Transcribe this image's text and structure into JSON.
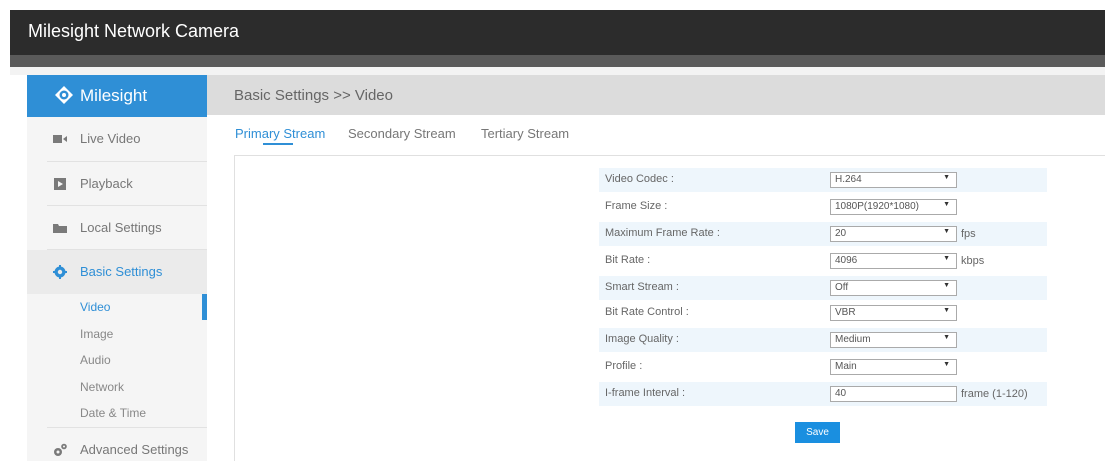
{
  "app": {
    "title": "Milesight Network Camera"
  },
  "brand": {
    "name": "Milesight",
    "accent_color": "#2f8fd6"
  },
  "sidebar": {
    "items": [
      {
        "label": "Live Video",
        "icon": "video-camera-icon"
      },
      {
        "label": "Playback",
        "icon": "play-icon"
      },
      {
        "label": "Local Settings",
        "icon": "folder-icon"
      },
      {
        "label": "Basic Settings",
        "icon": "gear-icon",
        "active": true
      },
      {
        "label": "Advanced Settings",
        "icon": "gears-icon"
      }
    ],
    "sub_items": [
      {
        "label": "Video",
        "active": true
      },
      {
        "label": "Image"
      },
      {
        "label": "Audio"
      },
      {
        "label": "Network"
      },
      {
        "label": "Date & Time"
      }
    ]
  },
  "header": {
    "breadcrumb": "Basic Settings >> Video"
  },
  "tabs": [
    {
      "label": "Primary Stream",
      "active": true
    },
    {
      "label": "Secondary Stream"
    },
    {
      "label": "Tertiary Stream"
    }
  ],
  "form": {
    "rows": [
      {
        "label": "Video Codec :",
        "value": "H.264",
        "unit": ""
      },
      {
        "label": "Frame Size :",
        "value": "1080P(1920*1080)",
        "unit": ""
      },
      {
        "label": "Maximum Frame Rate :",
        "value": "20",
        "unit": "fps"
      },
      {
        "label": "Bit Rate :",
        "value": "4096",
        "unit": "kbps"
      },
      {
        "label": "Smart Stream :",
        "value": "Off",
        "unit": ""
      },
      {
        "label": "Bit Rate Control :",
        "value": "VBR",
        "unit": ""
      },
      {
        "label": "Image Quality :",
        "value": "Medium",
        "unit": ""
      },
      {
        "label": "Profile :",
        "value": "Main",
        "unit": ""
      },
      {
        "label": "I-frame Interval :",
        "value": "40",
        "unit": "frame (1-120)"
      }
    ],
    "save_label": "Save"
  }
}
